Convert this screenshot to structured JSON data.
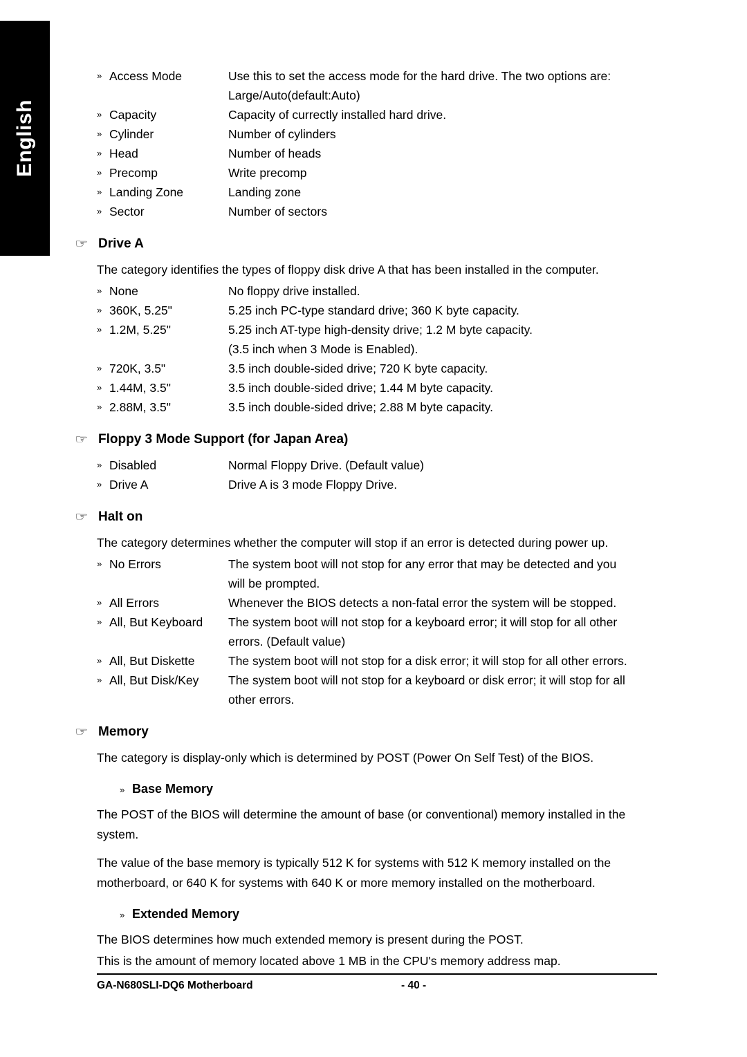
{
  "sidebar": {
    "label": "English"
  },
  "markers": {
    "double_arrow": "»",
    "hand": "☞"
  },
  "top_list": [
    {
      "term": "Access Mode",
      "desc": "Use this to set the access mode for the hard drive. The two options are:",
      "cont": "Large/Auto(default:Auto)"
    },
    {
      "term": "Capacity",
      "desc": "Capacity of currectly installed hard drive.",
      "cont": ""
    },
    {
      "term": "Cylinder",
      "desc": "Number of cylinders",
      "cont": ""
    },
    {
      "term": "Head",
      "desc": "Number of heads",
      "cont": ""
    },
    {
      "term": "Precomp",
      "desc": "Write precomp",
      "cont": ""
    },
    {
      "term": "Landing Zone",
      "desc": "Landing zone",
      "cont": ""
    },
    {
      "term": "Sector",
      "desc": "Number of sectors",
      "cont": ""
    }
  ],
  "drive_a": {
    "heading": "Drive A",
    "intro": "The category identifies the types of floppy disk drive A  that has been installed in the computer.",
    "items": [
      {
        "term": "None",
        "desc": "No floppy drive installed.",
        "cont": ""
      },
      {
        "term": "360K, 5.25\"",
        "desc": "5.25 inch PC-type standard drive; 360 K byte capacity.",
        "cont": ""
      },
      {
        "term": "1.2M, 5.25\"",
        "desc": "5.25 inch AT-type high-density drive; 1.2 M byte capacity.",
        "cont": "(3.5 inch when 3 Mode is Enabled)."
      },
      {
        "term": "720K, 3.5\"",
        "desc": "3.5 inch double-sided drive; 720 K byte capacity.",
        "cont": ""
      },
      {
        "term": "1.44M, 3.5\"",
        "desc": "3.5 inch double-sided drive; 1.44 M byte capacity.",
        "cont": ""
      },
      {
        "term": "2.88M, 3.5\"",
        "desc": "3.5 inch double-sided drive; 2.88 M byte capacity.",
        "cont": ""
      }
    ]
  },
  "floppy3mode": {
    "heading": "Floppy 3 Mode Support (for Japan Area)",
    "items": [
      {
        "term": "Disabled",
        "desc": "Normal Floppy Drive. (Default value)",
        "cont": ""
      },
      {
        "term": "Drive A",
        "desc": "Drive A is 3 mode Floppy Drive.",
        "cont": ""
      }
    ]
  },
  "halt_on": {
    "heading": "Halt on",
    "intro": "The category determines whether the computer will stop if an error is detected during power up.",
    "items": [
      {
        "term": "No Errors",
        "desc": "The system boot will not stop for any error that may be detected and  you",
        "cont": "will be prompted."
      },
      {
        "term": "All Errors",
        "desc": "Whenever the BIOS detects a non-fatal error the system will be stopped.",
        "cont": ""
      },
      {
        "term": "All, But Keyboard",
        "desc": "The system boot will not stop for a keyboard error; it will stop for all other",
        "cont": "errors. (Default value)"
      },
      {
        "term": "All, But Diskette",
        "desc": "The system boot will not stop for a disk error; it will stop for all other errors.",
        "cont": ""
      },
      {
        "term": "All, But Disk/Key",
        "desc": "The system boot will not stop for a keyboard or disk error; it will stop for all",
        "cont": "other errors."
      }
    ]
  },
  "memory": {
    "heading": "Memory",
    "intro": "The category is display-only which is determined by POST (Power On Self Test) of the BIOS.",
    "base": {
      "heading": "Base Memory",
      "p1_line1": "The POST of the BIOS will determine the amount of base (or conventional) memory installed in the",
      "p1_line2": "system.",
      "p2_line1": "The value of the base memory is typically 512 K for systems with 512 K memory installed on the",
      "p2_line2": "motherboard, or 640 K for systems with 640 K or more memory installed on the motherboard."
    },
    "extended": {
      "heading": "Extended Memory",
      "p1": "The BIOS determines how much extended memory is present during the POST.",
      "p2": "This is the amount of memory located above 1 MB in the CPU's memory address map."
    }
  },
  "footer": {
    "left": "GA-N680SLI-DQ6 Motherboard",
    "center": "- 40 -"
  }
}
